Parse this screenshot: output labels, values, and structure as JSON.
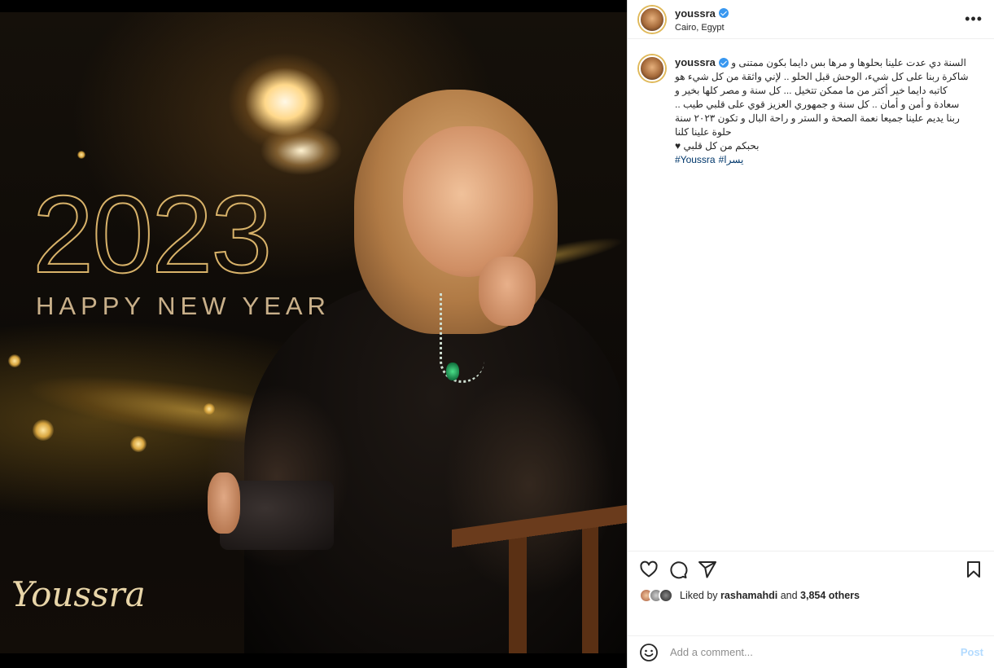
{
  "post": {
    "username": "youssra",
    "location": "Cairo, Egypt",
    "image": {
      "year": "2023",
      "greeting": "HAPPY NEW YEAR",
      "signature": "Youssra"
    },
    "caption": {
      "line1": "السنة دي عدت علينا بحلوها و مرها بس دايما بكون ممتنى و",
      "line2": "شاكرة ربنا على كل شيء، الوحش قبل الحلو .. لإني واثقة من كل شيء هو",
      "line3": "كاتبه دايما خير أكتر من ما ممكن تتخيل ... كل سنة و مصر كلها بخير و",
      "line4": "سعادة و أمن و أمان .. كل سنة و جمهوري العزيز قوي على قلبي طيب ..",
      "line5": "ربنا يديم علينا جميعا نعمة الصحة و الستر و راحة البال و تكون ٢٠٢٣ سنة",
      "line6": "حلوة علينا كلنا",
      "line7": "بحبكم من كل قلبي ♥",
      "hashtags": [
        "#Youssra",
        "#يسرا"
      ]
    },
    "likes": {
      "prefix": "Liked by",
      "user": "rashamahdi",
      "joiner": "and",
      "others": "3,854 others"
    },
    "comment": {
      "placeholder": "Add a comment...",
      "post_label": "Post"
    }
  },
  "icons": {
    "more": "more-options-icon",
    "like": "heart-icon",
    "comment": "comment-icon",
    "share": "share-icon",
    "save": "bookmark-icon",
    "emoji": "emoji-icon"
  },
  "colors": {
    "verified": "#3897f0",
    "hashtag": "#00376b",
    "post_button": "#b3dbff",
    "avatar_ring": "#e0b95a"
  }
}
